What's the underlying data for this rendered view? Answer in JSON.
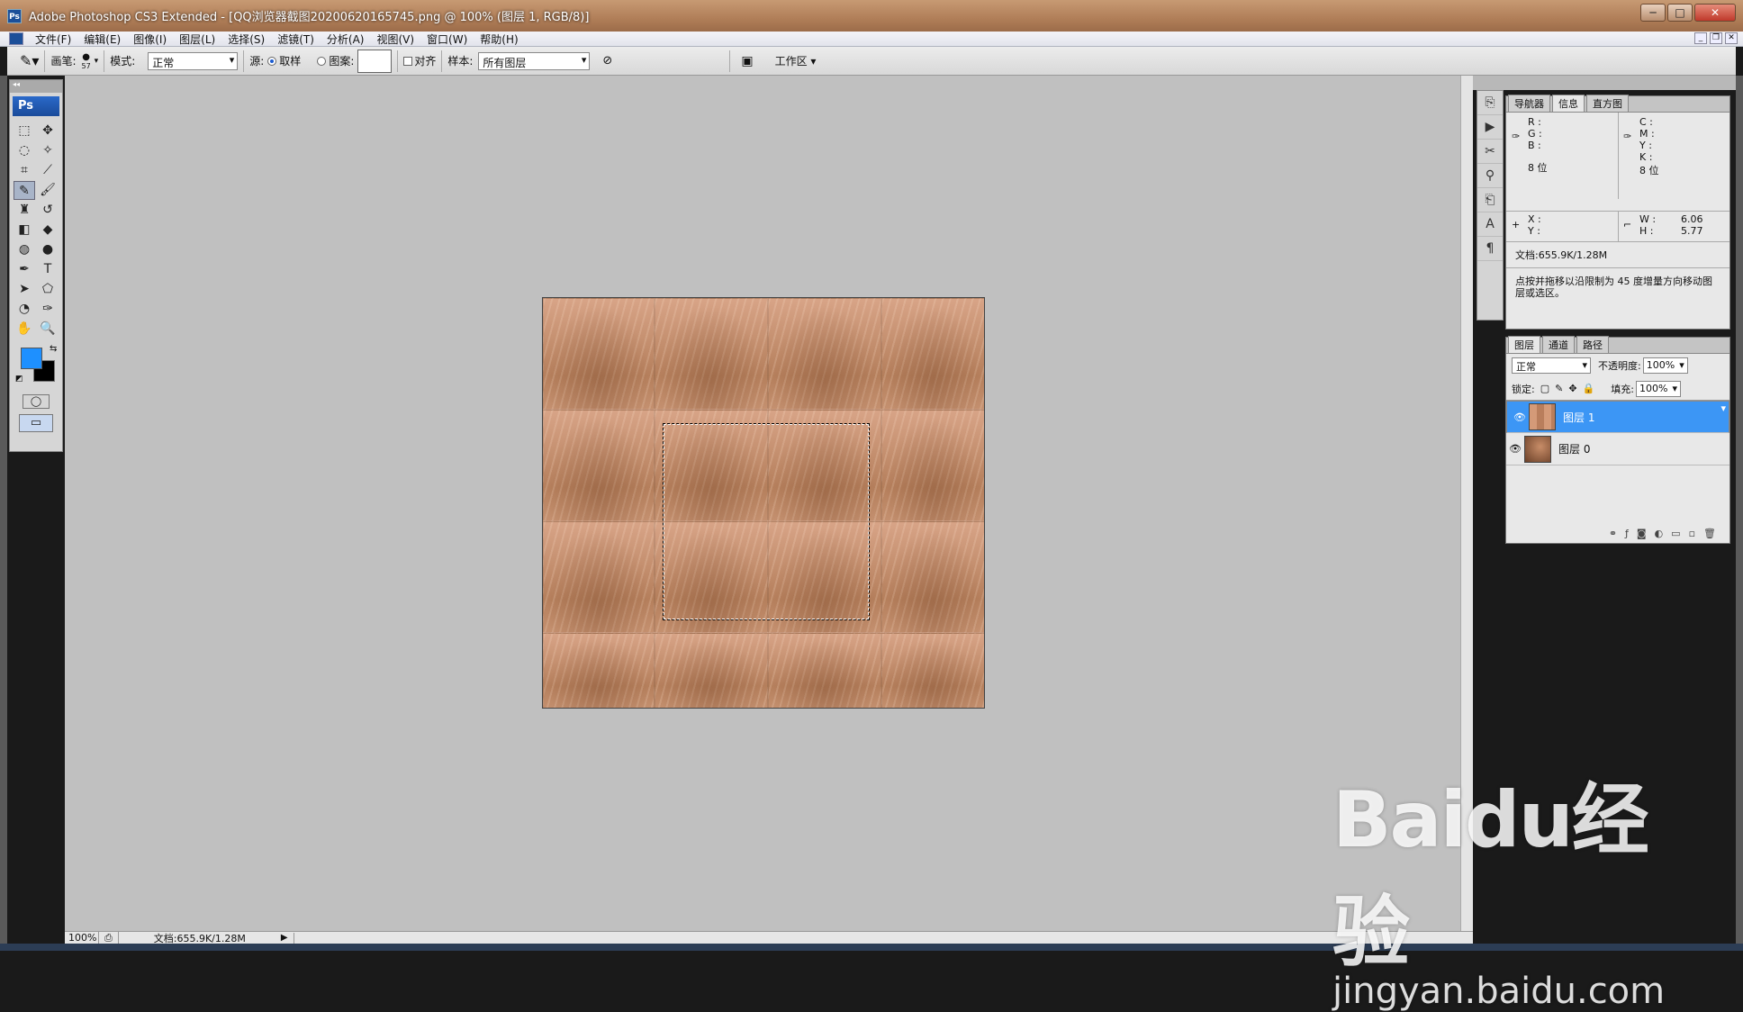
{
  "window": {
    "title": "Adobe Photoshop CS3 Extended - [QQ浏览器截图20200620165745.png @ 100% (图层 1, RGB/8)]",
    "icon": "ps-app-icon"
  },
  "menu": [
    "文件(F)",
    "编辑(E)",
    "图像(I)",
    "图层(L)",
    "选择(S)",
    "滤镜(T)",
    "分析(A)",
    "视图(V)",
    "窗口(W)",
    "帮助(H)"
  ],
  "options": {
    "brush_label": "画笔:",
    "brush_size": "57",
    "mode_label": "模式:",
    "mode_value": "正常",
    "source_label": "源:",
    "sampled_label": "取样",
    "pattern_label": "图案:",
    "aligned_label": "对齐",
    "sample_label": "样本:",
    "sample_value": "所有图层",
    "workspace_label": "工作区 ▾"
  },
  "toolbox": {
    "logo": "Ps"
  },
  "info_panel": {
    "tabs": [
      "导航器",
      "信息",
      "直方图"
    ],
    "rgb": [
      "R :",
      "G :",
      "B :"
    ],
    "cmyk": [
      "C :",
      "M :",
      "Y :",
      "K :"
    ],
    "bits_left": "8 位",
    "bits_right": "8 位",
    "xy": [
      "X :",
      "Y :"
    ],
    "w_label": "W :",
    "h_label": "H :",
    "w_value": "6.06",
    "h_value": "5.77",
    "doc": "文档:655.9K/1.28M",
    "hint": "点按并拖移以沿限制为 45 度增量方向移动图层或选区。"
  },
  "layers_panel": {
    "tabs": [
      "图层",
      "通道",
      "路径"
    ],
    "blend_mode": "正常",
    "opacity_label": "不透明度:",
    "opacity_value": "100%",
    "lock_label": "锁定:",
    "fill_label": "填充:",
    "fill_value": "100%",
    "layers": [
      {
        "name": "图层 1",
        "selected": true
      },
      {
        "name": "图层 0",
        "selected": false
      }
    ]
  },
  "status": {
    "zoom": "100%",
    "doc": "文档:655.9K/1.28M"
  },
  "watermark": {
    "line1": "Baidu经验",
    "line2": "jingyan.baidu.com"
  },
  "colors": {
    "foreground": "#1e90ff",
    "background": "#000000",
    "selection": "#3c96f5"
  }
}
